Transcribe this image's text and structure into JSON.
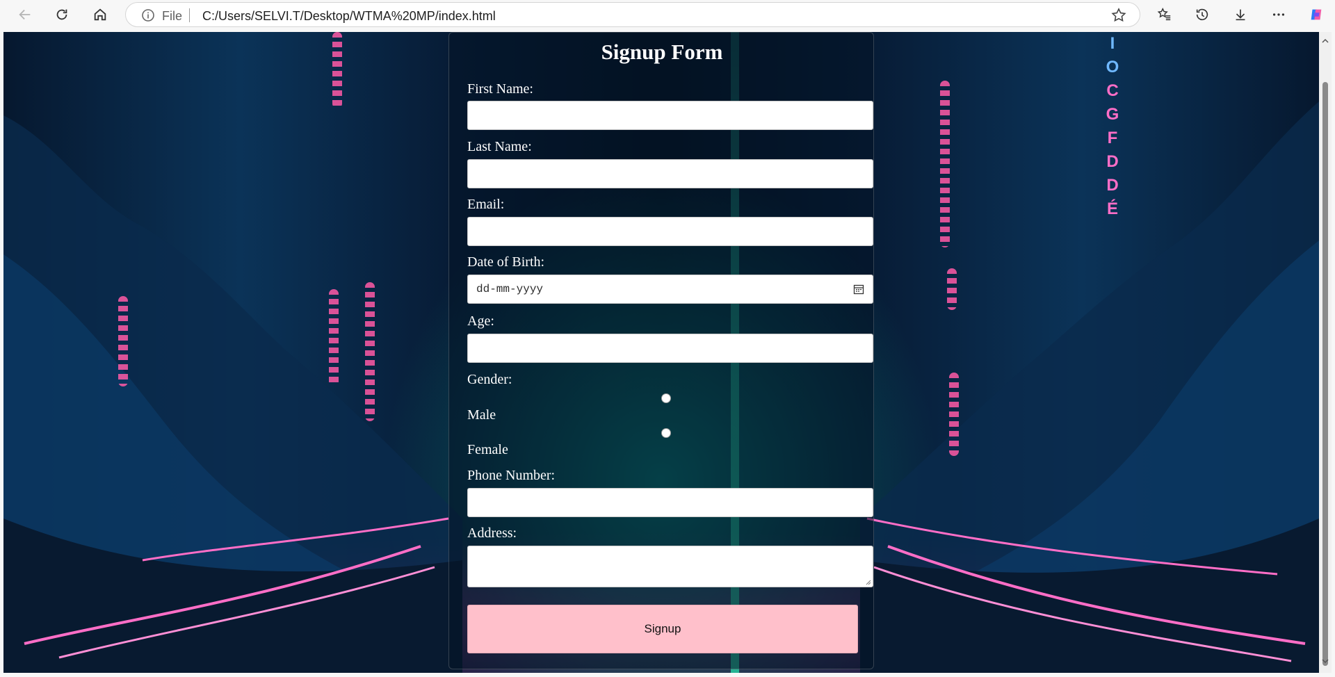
{
  "browser": {
    "address_scheme_label": "File",
    "url": "C:/Users/SELVI.T/Desktop/WTMA%20MP/index.html",
    "icons": [
      "back-icon",
      "refresh-icon",
      "home-icon",
      "info-icon",
      "star-icon",
      "favorites-icon",
      "history-icon",
      "download-icon",
      "more-icon",
      "copilot-icon"
    ]
  },
  "background": {
    "letters": [
      "I",
      "O",
      "C",
      "G",
      "F",
      "D",
      "D",
      "É"
    ],
    "colors": {
      "deep_blue": "#06182f",
      "neon_pink": "#ff5aa6",
      "teal": "#28c8a0"
    }
  },
  "form": {
    "title": "Signup Form",
    "first_name_label": "First Name:",
    "last_name_label": "Last Name:",
    "email_label": "Email:",
    "dob_label": "Date of Birth:",
    "dob_placeholder": "dd-mm-yyyy",
    "age_label": "Age:",
    "gender_label": "Gender:",
    "gender_options": [
      "Male",
      "Female"
    ],
    "phone_label": "Phone Number:",
    "address_label": "Address:",
    "submit_label": "Signup",
    "colors": {
      "submit_bg": "#ffc0cb",
      "label": "#ffffff"
    }
  }
}
